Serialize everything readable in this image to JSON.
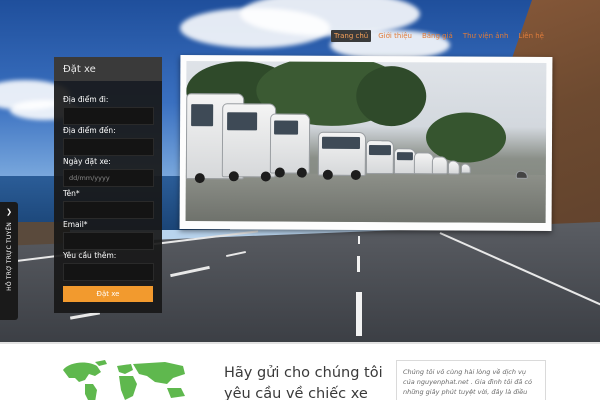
{
  "nav": {
    "items": [
      {
        "label": "Trang chủ",
        "active": true
      },
      {
        "label": "Giới thiệu",
        "active": false
      },
      {
        "label": "Bảng giá",
        "active": false
      },
      {
        "label": "Thư viện ảnh",
        "active": false
      },
      {
        "label": "Liên hệ",
        "active": false
      }
    ]
  },
  "support_tab": {
    "label": "HỖ TRỢ TRỰC TUYẾN",
    "icon": "chevron-right-icon"
  },
  "booking_form": {
    "title": "Đặt xe",
    "fields": {
      "pickup": {
        "label": "Địa điểm đi:",
        "value": "",
        "placeholder": ""
      },
      "destination": {
        "label": "Địa điểm đến:",
        "value": "",
        "placeholder": ""
      },
      "date": {
        "label": "Ngày đặt xe:",
        "value": "",
        "placeholder": "dd/mm/yyyy"
      },
      "name": {
        "label": "Tên*",
        "value": "",
        "placeholder": ""
      },
      "email": {
        "label": "Email*",
        "value": "",
        "placeholder": ""
      },
      "request": {
        "label": "Yêu cầu thêm:",
        "value": "",
        "placeholder": ""
      }
    },
    "submit_label": "Đặt xe",
    "submit_color": "#f29a2e"
  },
  "bottom": {
    "cta_title": "Hãy gửi cho chúng tôi yêu cầu về chiếc xe",
    "testimonial": "Chúng tôi vô cùng hài lòng về dịch vụ của nguyenphat.net . Gia đình tôi đã có những giây phút tuyệt vời, đây là điều"
  },
  "colors": {
    "accent": "#e07c3a",
    "map_green": "#5fb84e",
    "form_bg": "#181818"
  }
}
